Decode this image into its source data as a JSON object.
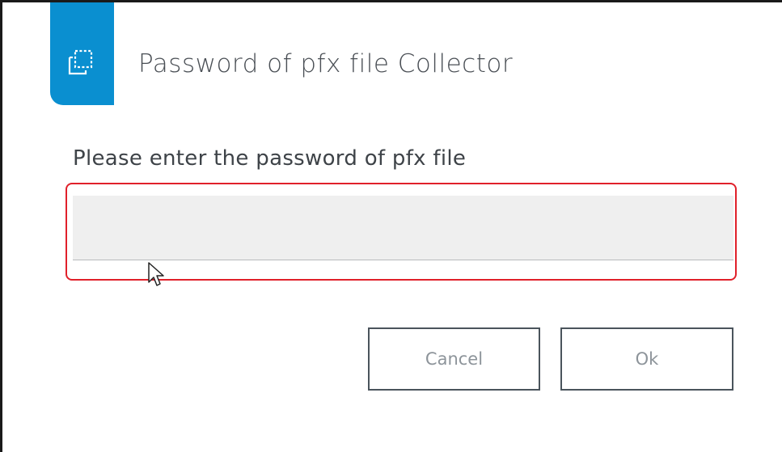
{
  "dialog": {
    "title": "Password of pfx file Collector",
    "header_icon": "copy-dashed-icon",
    "accent_color": "#0a8fd0",
    "prompt": "Please enter the password of pfx file"
  },
  "password_field": {
    "value": "",
    "placeholder": "",
    "type": "password",
    "highlight_color": "#e0202a"
  },
  "cursor": {
    "icon": "mouse-pointer-icon"
  },
  "buttons": {
    "cancel_label": "Cancel",
    "ok_label": "Ok"
  }
}
